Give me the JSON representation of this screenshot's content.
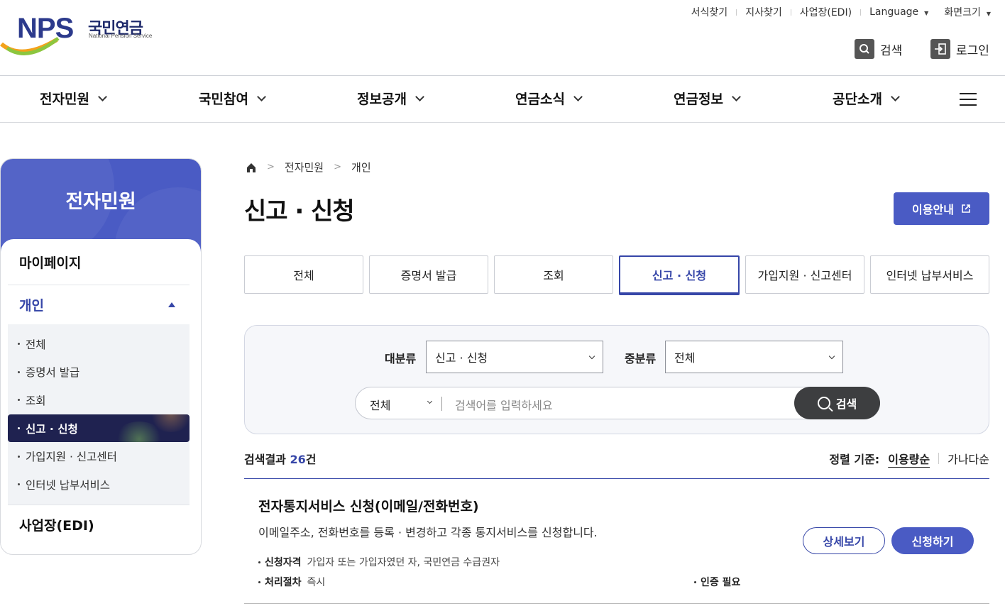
{
  "header": {
    "logo": {
      "mark": "NPS",
      "name_ko": "국민연금",
      "name_en": "National Pension Service"
    },
    "util": [
      "서식찾기",
      "지사찾기",
      "사업장(EDI)"
    ],
    "language": "Language",
    "screen_size": "화면크기",
    "search_label": "검색",
    "login_label": "로그인"
  },
  "gnb": [
    "전자민원",
    "국민참여",
    "정보공개",
    "연금소식",
    "연금정보",
    "공단소개"
  ],
  "lnb": {
    "title": "전자민원",
    "mypage": "마이페이지",
    "personal": "개인",
    "sub": [
      "전체",
      "증명서 발급",
      "조회",
      "신고 · 신청",
      "가입지원 · 신고센터",
      "인터넷 납부서비스"
    ],
    "business": "사업장(EDI)"
  },
  "breadcrumb": [
    "전자민원",
    "개인"
  ],
  "page": {
    "title": "신고 · 신청",
    "guide_label": "이용안내"
  },
  "tabs": [
    "전체",
    "증명서 발급",
    "조회",
    "신고 · 신청",
    "가입지원 · 신고센터",
    "인터넷 납부서비스"
  ],
  "filter": {
    "major_label": "대분류",
    "major_value": "신고 · 신청",
    "minor_label": "중분류",
    "minor_value": "전체",
    "scope_value": "전체",
    "placeholder": "검색어를 입력하세요",
    "search_button": "검색"
  },
  "results": {
    "count_prefix": "검색결과",
    "count": "26",
    "count_suffix": "건",
    "sort_label": "정렬 기준:",
    "sort_options": [
      "이용량순",
      "가나다순"
    ]
  },
  "items": [
    {
      "title": "전자통지서비스 신청(이메일/전화번호)",
      "desc": "이메일주소, 전화번호를 등록 · 변경하고 각종 통지서비스를 신청합니다.",
      "eligibility_label": "신청자격",
      "eligibility": "가입자 또는 가입자였던 자, 국민연금 수급권자",
      "process_label": "처리절차",
      "process": "즉시",
      "auth": "인증 필요",
      "detail_button": "상세보기",
      "apply_button": "신청하기"
    }
  ],
  "colors": {
    "primary": "#4a5bc4",
    "navy": "#1f2250",
    "accent": "#3646a8"
  }
}
